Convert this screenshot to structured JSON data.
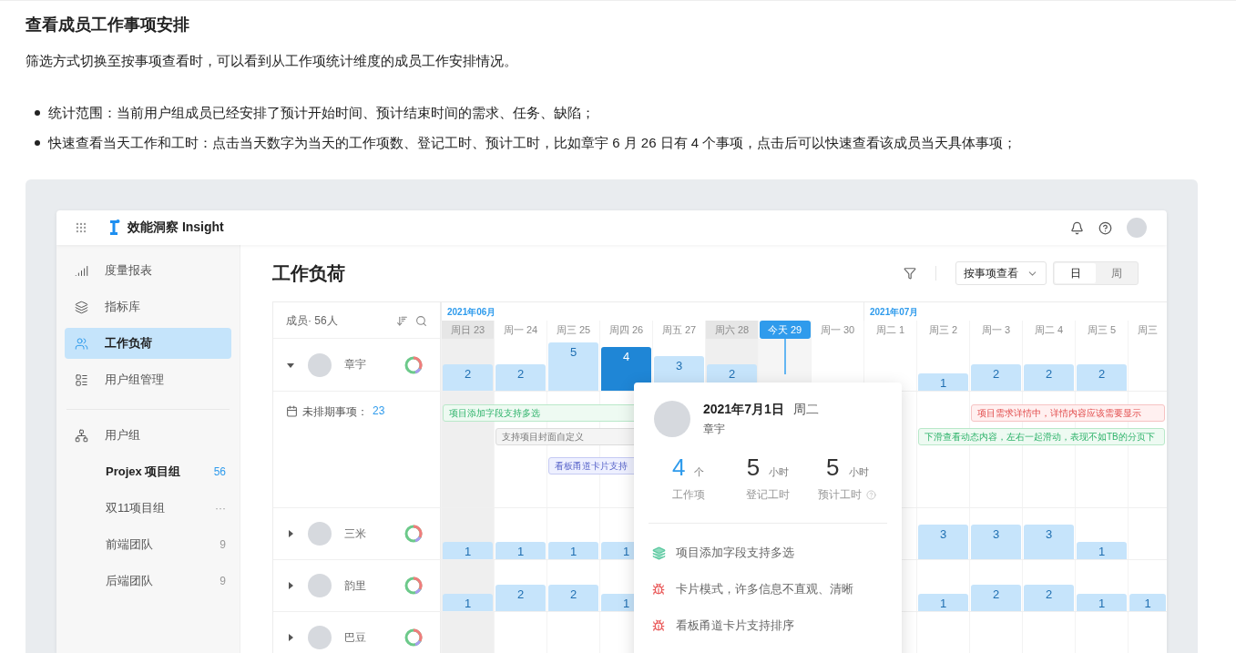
{
  "doc": {
    "heading": "查看成员工作事项安排",
    "intro": "筛选方式切换至按事项查看时，可以看到从工作项统计维度的成员工作安排情况。",
    "bullets": [
      "统计范围：当前用户组成员已经安排了预计开始时间、预计结束时间的需求、任务、缺陷；",
      "快速查看当天工作和工时：点击当天数字为当天的工作项数、登记工时、预计工时，比如章宇 6 月 26 日有 4 个事项，点击后可以快速查看该成员当天具体事项；"
    ]
  },
  "app": {
    "brand": "效能洞察 Insight"
  },
  "sidebar": {
    "nav": [
      {
        "label": "度量报表",
        "selected": false
      },
      {
        "label": "指标库",
        "selected": false
      },
      {
        "label": "工作负荷",
        "selected": true
      },
      {
        "label": "用户组管理",
        "selected": false
      }
    ],
    "groups_label": "用户组",
    "groups": [
      {
        "label": "Projex 项目组",
        "count": "56",
        "selected": true
      },
      {
        "label": "双11项目组",
        "count": "···",
        "selected": false
      },
      {
        "label": "前端团队",
        "count": "9",
        "selected": false
      },
      {
        "label": "后端团队",
        "count": "9",
        "selected": false
      }
    ]
  },
  "page": {
    "title": "工作负荷",
    "view_select": "按事项查看",
    "segments": [
      {
        "label": "日",
        "selected": true
      },
      {
        "label": "周",
        "selected": false
      }
    ]
  },
  "table": {
    "member_header": "成员· 56人",
    "days": [
      {
        "label": "周日 23",
        "month": "2021年06月",
        "weekend": true,
        "today": false
      },
      {
        "label": "周一 24",
        "weekend": false,
        "today": false
      },
      {
        "label": "周三 25",
        "weekend": false,
        "today": false
      },
      {
        "label": "周四 26",
        "weekend": false,
        "today": false
      },
      {
        "label": "周五 27",
        "weekend": false,
        "today": false
      },
      {
        "label": "周六 28",
        "weekend": true,
        "today": false
      },
      {
        "label": "今天 29",
        "weekend": false,
        "today": true
      },
      {
        "label": "周一 30",
        "weekend": false,
        "today": false
      },
      {
        "label": "周二 1",
        "month": "2021年07月",
        "weekend": false,
        "today": false
      },
      {
        "label": "周三 2",
        "weekend": false,
        "today": false
      },
      {
        "label": "周一 3",
        "weekend": false,
        "today": false
      },
      {
        "label": "周二 4",
        "weekend": false,
        "today": false
      },
      {
        "label": "周三 5",
        "weekend": false,
        "today": false
      },
      {
        "label": "周三",
        "weekend": false,
        "today": false
      }
    ],
    "members": [
      {
        "name": "章宇",
        "expanded": true,
        "cells": [
          {
            "count": "2",
            "selected": false
          },
          {
            "count": "2",
            "selected": false
          },
          {
            "count": "5",
            "selected": false
          },
          {
            "count": "4",
            "selected": true
          },
          {
            "count": "3",
            "selected": false
          },
          {
            "count": "2",
            "selected": false
          },
          null,
          null,
          null,
          {
            "count": "1",
            "selected": false
          },
          {
            "count": "2",
            "selected": false
          },
          {
            "count": "2",
            "selected": false
          },
          {
            "count": "2",
            "selected": false
          },
          null
        ],
        "unscheduled": {
          "label": "未排期事项：",
          "count": "23",
          "tasks": [
            {
              "title": "项目添加字段支持多选",
              "kind": "requirement"
            },
            {
              "title": "支持项目封面自定义",
              "kind": "task"
            },
            {
              "title": "看板甬道卡片支持",
              "kind": "feature"
            },
            {
              "title": "项目需求详情中，详情内容应该需要显示",
              "kind": "defect"
            },
            {
              "title": "下滑查看动态内容，左右一起滑动，表现不如TB的分页下",
              "kind": "requirement"
            }
          ]
        }
      },
      {
        "name": "三米",
        "expanded": false,
        "cells": [
          {
            "count": "1",
            "selected": false
          },
          {
            "count": "1",
            "selected": false
          },
          {
            "count": "1",
            "selected": false
          },
          {
            "count": "1",
            "selected": false
          },
          null,
          null,
          null,
          null,
          null,
          {
            "count": "3",
            "selected": false
          },
          {
            "count": "3",
            "selected": false
          },
          {
            "count": "3",
            "selected": false
          },
          {
            "count": "1",
            "selected": false
          },
          null
        ]
      },
      {
        "name": "韵里",
        "expanded": false,
        "cells": [
          {
            "count": "1",
            "selected": false
          },
          {
            "count": "2",
            "selected": false
          },
          {
            "count": "2",
            "selected": false
          },
          {
            "count": "1",
            "selected": false
          },
          null,
          null,
          null,
          null,
          null,
          {
            "count": "1",
            "selected": false
          },
          {
            "count": "2",
            "selected": false
          },
          {
            "count": "2",
            "selected": false
          },
          {
            "count": "1",
            "selected": false
          },
          {
            "count": "1",
            "selected": false
          }
        ]
      },
      {
        "name": "巴豆",
        "expanded": false,
        "cells": [
          null,
          null,
          null,
          null,
          null,
          null,
          null,
          null,
          null,
          null,
          null,
          null,
          null,
          null
        ]
      }
    ]
  },
  "popover": {
    "date": "2021年7月1日",
    "weekday": "周二",
    "name": "章宇",
    "stats": [
      {
        "value": "4",
        "unit": "个",
        "label": "工作项",
        "highlight": true,
        "help": false
      },
      {
        "value": "5",
        "unit": "小时",
        "label": "登记工时",
        "highlight": false,
        "help": false
      },
      {
        "value": "5",
        "unit": "小时",
        "label": "预计工时",
        "highlight": false,
        "help": true
      }
    ],
    "items": [
      {
        "title": "项目添加字段支持多选",
        "kind": "requirement"
      },
      {
        "title": "卡片模式，许多信息不直观、清晰",
        "kind": "defect"
      },
      {
        "title": "看板甬道卡片支持排序",
        "kind": "defect"
      }
    ]
  }
}
